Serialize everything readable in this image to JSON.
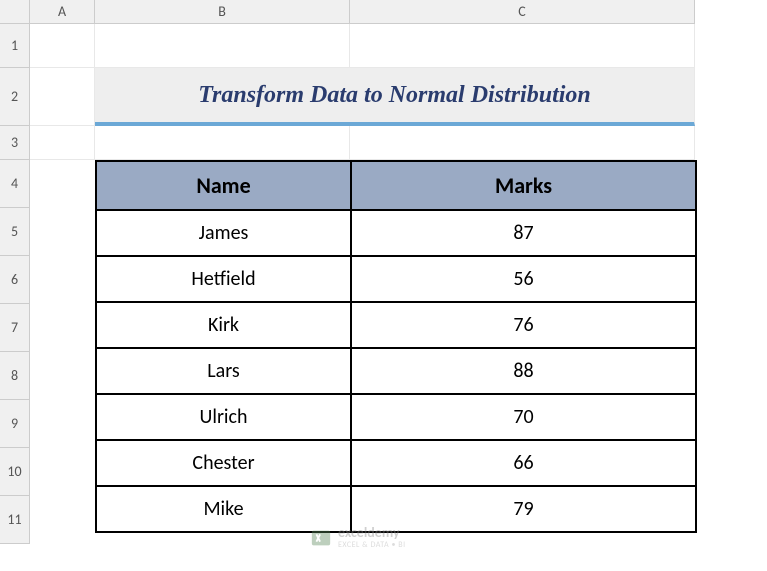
{
  "columns": [
    "A",
    "B",
    "C"
  ],
  "rows": [
    "1",
    "2",
    "3",
    "4",
    "5",
    "6",
    "7",
    "8",
    "9",
    "10",
    "11"
  ],
  "title": "Transform Data to Normal Distribution",
  "table": {
    "headers": {
      "name": "Name",
      "marks": "Marks"
    },
    "rows": [
      {
        "name": "James",
        "marks": "87"
      },
      {
        "name": "Hetfield",
        "marks": "56"
      },
      {
        "name": "Kirk",
        "marks": "76"
      },
      {
        "name": "Lars",
        "marks": "88"
      },
      {
        "name": "Ulrich",
        "marks": "70"
      },
      {
        "name": "Chester",
        "marks": "66"
      },
      {
        "name": "Mike",
        "marks": "79"
      }
    ]
  },
  "watermark": {
    "brand": "exceldemy",
    "tagline": "EXCEL & DATA • BI"
  }
}
